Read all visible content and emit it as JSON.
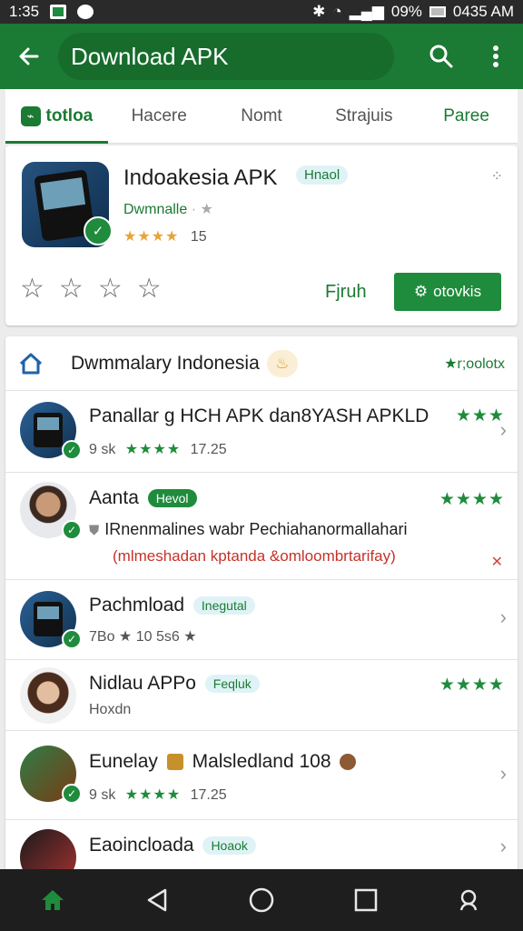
{
  "status_bar": {
    "time": "1:35",
    "battery": "09%",
    "clock": "0435 AM"
  },
  "app_bar": {
    "back_icon": "arrow-left-icon",
    "title": "Download APK",
    "search_icon": "search-icon",
    "more_icon": "more-vert-icon",
    "color": "#1b7a33"
  },
  "tabs": [
    {
      "label": "totloa",
      "active": true
    },
    {
      "label": "Hacere"
    },
    {
      "label": "Nomt"
    },
    {
      "label": "Strajuis"
    },
    {
      "label": "Paree"
    }
  ],
  "featured": {
    "title": "Indoakesia APK",
    "badge": "Hnaol",
    "subtitle": "Dwmnalle",
    "stars": "★★★★",
    "rating_count": "15",
    "link_label": "Fjruh",
    "button_label": "otovkis"
  },
  "list": {
    "header_title": "Dwmmalary Indonesia",
    "header_right": "★r;oolotx",
    "items": [
      {
        "title": "Panallar g HCH APK dan8YASH APKLD",
        "meta_size": "9 sk",
        "meta_stars": "★★★★",
        "meta_time": "17.25",
        "right_stars": "★★★"
      },
      {
        "title": "Aanta",
        "badge": "Hevol",
        "line2": "IRnenmalines wabr Pechiahanormallahari",
        "line3": "(mlmeshadan kptanda &omloombrtarifay)",
        "right_stars": "★★★★",
        "close": "✕"
      },
      {
        "title": "Pachmload",
        "badge": "Inegutal",
        "meta": "7Bo ★ 10 5s6 ★"
      },
      {
        "title": "Nidlau APPo",
        "badge": "Feqluk",
        "meta": "Hoxdn",
        "right_stars": "★★★★"
      },
      {
        "title": "Eunelay",
        "title_rest": "Malsledland 108",
        "meta_size": "9 sk",
        "meta_stars": "★★★★",
        "meta_time": "17.25"
      },
      {
        "title": "Eaoincloada",
        "badge": "Hoaok"
      }
    ]
  },
  "nav": {
    "home_icon": "home-icon",
    "back_icon": "back-triangle-icon",
    "circle_icon": "home-circle-icon",
    "recent_icon": "recents-square-icon",
    "search_icon": "search-icon"
  }
}
